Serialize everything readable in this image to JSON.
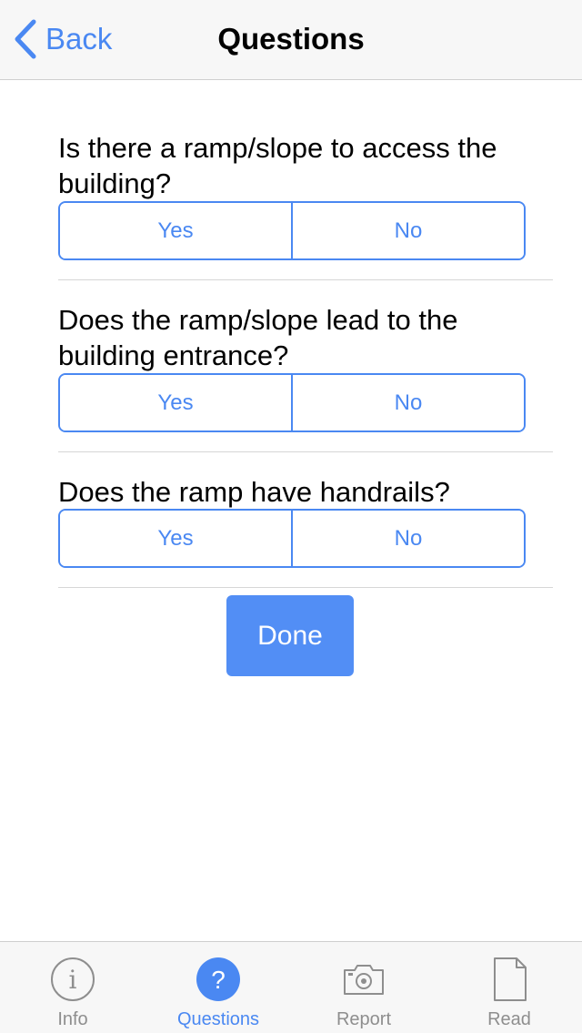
{
  "nav": {
    "back_label": "Back",
    "title": "Questions"
  },
  "questions": [
    {
      "text": "Is there a ramp/slope to access the building?",
      "yes": "Yes",
      "no": "No"
    },
    {
      "text": "Does the ramp/slope lead to the building entrance?",
      "yes": "Yes",
      "no": "No"
    },
    {
      "text": "Does the ramp have handrails?",
      "yes": "Yes",
      "no": "No"
    }
  ],
  "done_label": "Done",
  "tabs": [
    {
      "label": "Info",
      "icon": "info-icon",
      "active": false
    },
    {
      "label": "Questions",
      "icon": "question-icon",
      "active": true
    },
    {
      "label": "Report",
      "icon": "camera-icon",
      "active": false
    },
    {
      "label": "Read",
      "icon": "document-icon",
      "active": false
    }
  ],
  "colors": {
    "accent": "#4a88f2",
    "done_button": "#528ef5",
    "inactive_tab": "#8e8e8e",
    "bar_background": "#f7f7f7"
  }
}
